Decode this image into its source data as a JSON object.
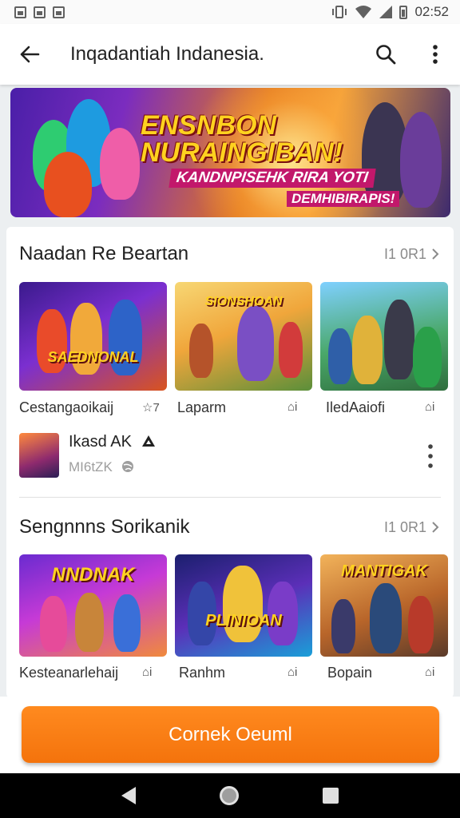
{
  "status_bar": {
    "time": "02:52",
    "icons": [
      "image-icon",
      "bag-icon",
      "photo-icon",
      "vibrate-icon",
      "wifi-icon",
      "signal-icon",
      "battery-icon"
    ]
  },
  "app_bar": {
    "title": "Inqadantiah Indanesia.",
    "icons": [
      "back-arrow-icon",
      "search-icon",
      "more-vert-icon"
    ]
  },
  "banner": {
    "title_line1": "ENSNBON",
    "title_line2": "NURAINGIBAN!",
    "subtitle": "KANDNPISEHK RIRA YOTI",
    "tagline": "DEMHIBIRAPIS!"
  },
  "section1": {
    "title": "Naadan Re Beartan",
    "more_label": "I1 0R1",
    "tiles": [
      {
        "art_title": "SAEDNONAL",
        "label": "Cestangaoikaij",
        "badge": "☆7"
      },
      {
        "art_title": "SIONSHOAN",
        "label": "Laparm",
        "badge": "⌂i"
      },
      {
        "art_title": "",
        "label": "IledAaiofi",
        "badge": "⌂i"
      }
    ]
  },
  "list_item": {
    "title": "Ikasd AK",
    "subtitle": "MI6tZK"
  },
  "section2": {
    "title": "Sengnnns Sorikanik",
    "more_label": "I1 0R1",
    "tiles": [
      {
        "art_title": "NNDNAK",
        "label": "Kesteanarlehaij",
        "badge": "⌂i"
      },
      {
        "art_title": "PLINIOAN",
        "label": "Ranhm",
        "badge": "⌂i"
      },
      {
        "art_title": "MANTIGAK",
        "label": "Bopain",
        "badge": "⌂i"
      }
    ]
  },
  "cta": {
    "label": "Cornek Oeuml"
  },
  "colors": {
    "accent": "#f4730c",
    "app_bar_bg": "#ffffff",
    "text_primary": "#212121",
    "text_secondary": "#8a8a8a"
  }
}
